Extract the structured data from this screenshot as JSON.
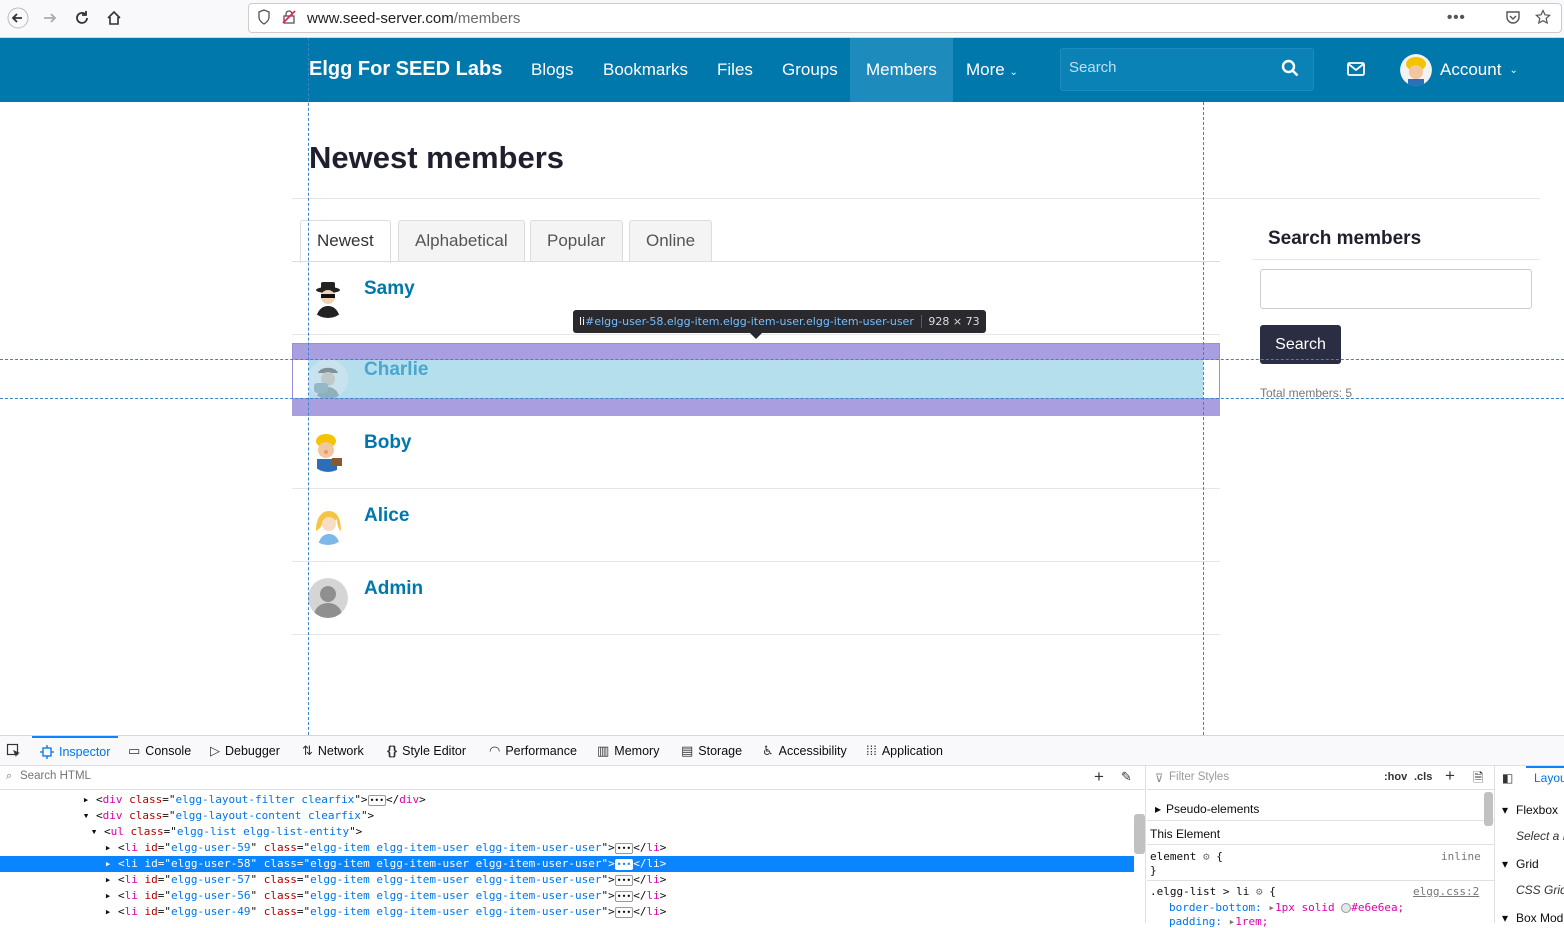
{
  "browser": {
    "url_domain": "www.seed-server.com",
    "url_path": "/members"
  },
  "site": {
    "title": "Elgg For SEED Labs",
    "menu": [
      "Blogs",
      "Bookmarks",
      "Files",
      "Groups",
      "Members",
      "More"
    ],
    "active_menu": "Members",
    "search_placeholder": "Search",
    "account_label": "Account"
  },
  "main": {
    "page_title": "Newest members",
    "tabs": [
      "Newest",
      "Alphabetical",
      "Popular",
      "Online"
    ],
    "active_tab": "Newest",
    "members": [
      "Samy",
      "Charlie",
      "Boby",
      "Alice",
      "Admin"
    ]
  },
  "sidebar": {
    "title": "Search members",
    "search_button": "Search",
    "total_members": "Total members: 5"
  },
  "inspector_tooltip": {
    "tag": "li",
    "selector": "#elgg-user-58.elgg-item.elgg-item-user.elgg-item-user-user",
    "size": "928 × 73"
  },
  "devtools": {
    "tabs": [
      "Inspector",
      "Console",
      "Debugger",
      "Network",
      "Style Editor",
      "Performance",
      "Memory",
      "Storage",
      "Accessibility",
      "Application"
    ],
    "active_tab": "Inspector",
    "search_html_placeholder": "Search HTML",
    "markup": [
      {
        "tag": "div",
        "cls": "elgg-layout-filter clearfix",
        "closed": true
      },
      {
        "tag": "div",
        "cls": "elgg-layout-content clearfix",
        "open": true
      },
      {
        "tag": "ul",
        "cls": "elgg-list elgg-list-entity",
        "open": true
      },
      {
        "tag": "li",
        "id": "elgg-user-59",
        "cls": "elgg-item elgg-item-user elgg-item-user-user"
      },
      {
        "tag": "li",
        "id": "elgg-user-58",
        "cls": "elgg-item elgg-item-user elgg-item-user-user",
        "selected": true
      },
      {
        "tag": "li",
        "id": "elgg-user-57",
        "cls": "elgg-item elgg-item-user elgg-item-user-user"
      },
      {
        "tag": "li",
        "id": "elgg-user-56",
        "cls": "elgg-item elgg-item-user elgg-item-user-user"
      },
      {
        "tag": "li",
        "id": "elgg-user-49",
        "cls": "elgg-item elgg-item-user elgg-item-user-user"
      }
    ],
    "filter_styles_placeholder": "Filter Styles",
    "hov": ":hov",
    "cls": ".cls",
    "pseudo_elements": "Pseudo-elements",
    "this_element": "This Element",
    "element_rule": "element",
    "element_rule_brace": "{",
    "element_rule_close": "}",
    "element_source": "inline",
    "rule_selector": ".elgg-list > li",
    "rule_source": "elgg.css:2",
    "prop1_name": "border-bottom:",
    "prop1_value": "1px solid",
    "prop1_color": "#e6e6ea;",
    "prop2_name": "padding:",
    "prop2_value": "1rem;",
    "layout_tab": "Layou",
    "flexbox": "Flexbox",
    "flexbox_hint": "Select a F",
    "grid": "Grid",
    "grid_hint": "CSS Grid",
    "box_model": "Box Mod"
  },
  "colors": {
    "brand": "#0078ac",
    "highlight_content": "#b6dfee",
    "highlight_padding": "#a99ee0",
    "devtools_selected": "#0a84ff"
  }
}
